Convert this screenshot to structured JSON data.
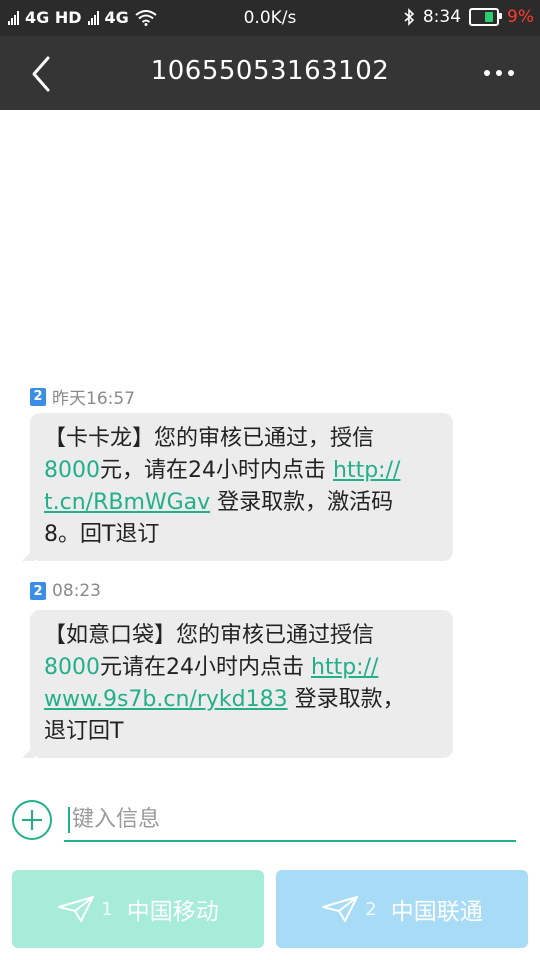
{
  "status_bar": {
    "network1": "4G HD",
    "sim2_label": "2",
    "network2": "4G",
    "speed": "0.0K/s",
    "time": "8:34",
    "battery_percent": "9%",
    "battery_level": 0.09,
    "colors": {
      "battery_fill": "#2ecc71",
      "battery_text": "#ff3b30"
    }
  },
  "header": {
    "title": "10655053163102",
    "back_icon": "chevron-left-icon",
    "more_icon": "more-dots-icon"
  },
  "messages": [
    {
      "sim": "2",
      "time": "昨天16:57",
      "parts": {
        "a": "【卡卡龙】您的审核已通过，授信",
        "amount": "8000",
        "b": "元，请在24小时内点击 ",
        "link1": "http://",
        "link2": "t.cn/RBmWGav",
        "c": " 登录取款，激活码",
        "d": "8。回T退订"
      }
    },
    {
      "sim": "2",
      "time": "08:23",
      "parts": {
        "a": "【如意口袋】您的审核已通过授信",
        "amount": "8000",
        "b": "元请在24小时内点击 ",
        "link1": "http://",
        "link2": "www.9s7b.cn/rykd183",
        "c": " 登录取款，",
        "d": "退订回T"
      }
    }
  ],
  "composer": {
    "placeholder": "键入信息",
    "add_icon": "plus-circle-icon"
  },
  "send_buttons": [
    {
      "num": "1",
      "label": "中国移动",
      "icon": "send-icon",
      "color": "#a6ecd8"
    },
    {
      "num": "2",
      "label": "中国联通",
      "icon": "send-icon",
      "color": "#a8dcf6"
    }
  ],
  "colors": {
    "accent": "#22b08a",
    "sim_badge": "#3a8ee6",
    "title_bar": "#353535"
  }
}
